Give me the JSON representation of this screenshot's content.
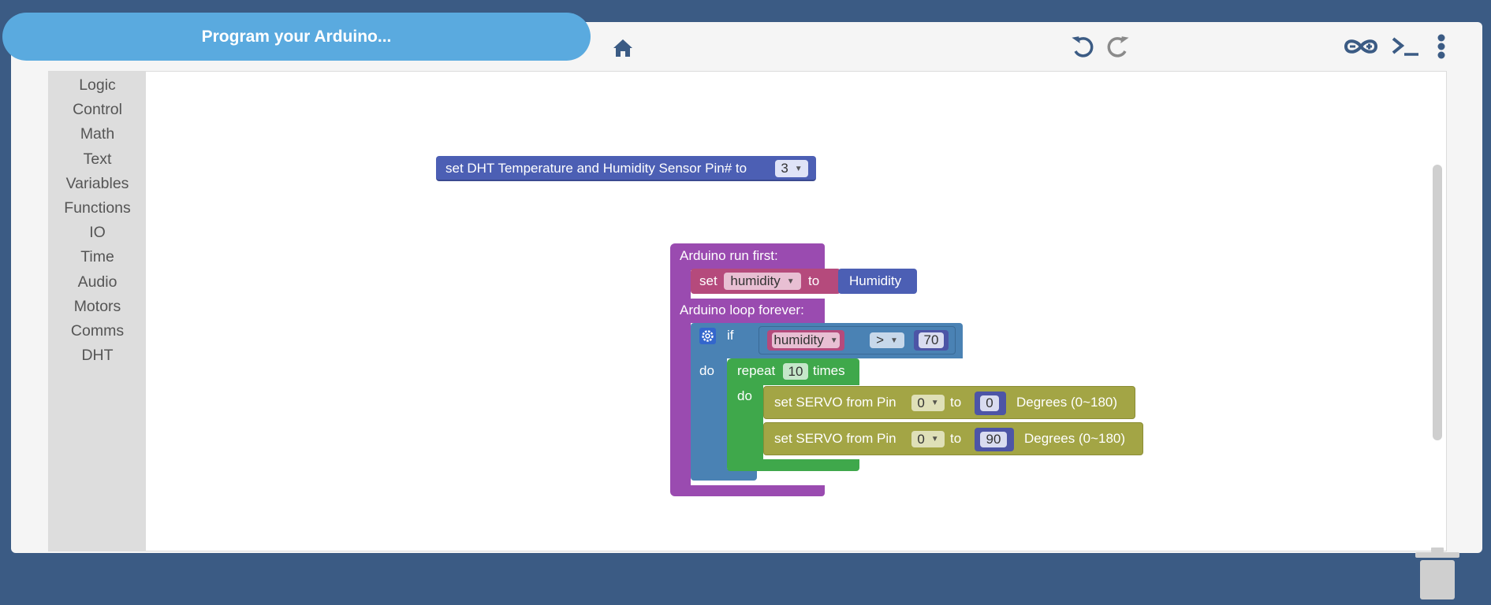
{
  "header": {
    "title": "Program your Arduino...",
    "home_icon": "home-icon",
    "undo_icon": "undo-icon",
    "redo_icon": "redo-icon",
    "arduino_icon": "arduino-infinity-icon",
    "terminal_icon": "terminal-icon",
    "menu_icon": "more-vert-icon"
  },
  "toolbox": {
    "categories": [
      "Logic",
      "Control",
      "Math",
      "Text",
      "Variables",
      "Functions",
      "IO",
      "Time",
      "Audio",
      "Motors",
      "Comms",
      "DHT"
    ]
  },
  "blocks": {
    "dht_set": {
      "label": "set DHT Temperature and Humidity Sensor Pin# to",
      "pin": "3"
    },
    "run_first": {
      "label": "Arduino run first:"
    },
    "set_var": {
      "set": "set",
      "var": "humidity",
      "to": "to",
      "value": "Humidity"
    },
    "loop_forever": {
      "label": "Arduino loop forever:"
    },
    "if_block": {
      "if": "if",
      "do": "do",
      "var": "humidity",
      "op": ">",
      "value": "70"
    },
    "repeat": {
      "repeat": "repeat",
      "count": "10",
      "times": "times",
      "do": "do"
    },
    "servo1": {
      "label": "set SERVO from Pin",
      "pin": "0",
      "to": "to",
      "value": "0",
      "suffix": "Degrees (0~180)"
    },
    "servo2": {
      "label": "set SERVO from Pin",
      "pin": "0",
      "to": "to",
      "value": "90",
      "suffix": "Degrees (0~180)"
    }
  },
  "colors": {
    "background": "#3b5b84",
    "title_pill": "#5aaadf",
    "dht_block": "#4c5fb4",
    "arduino_block": "#9a4bb0",
    "variable_block": "#b54a7c",
    "logic_block": "#4a82b4",
    "loop_block": "#3fa84b",
    "servo_block": "#a3a545",
    "math_block": "#4d55a6",
    "toolbox": "#dddddd"
  },
  "workspace": {
    "trash_icon": "trash-icon"
  }
}
